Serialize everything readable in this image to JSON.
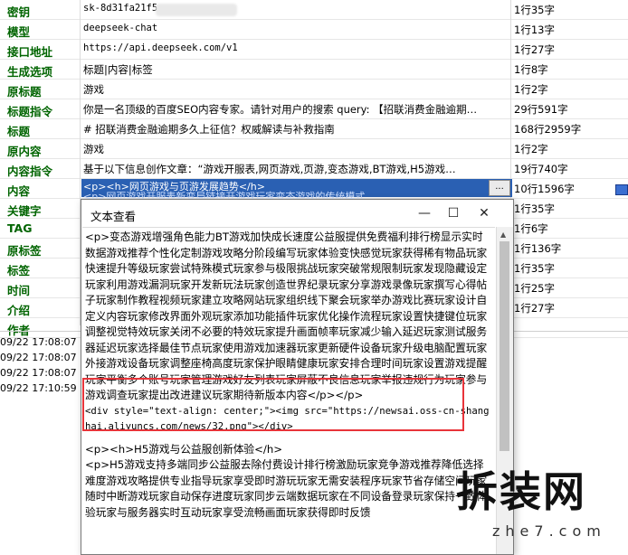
{
  "rows": [
    {
      "label": "密钥",
      "value": "sk-8d31fa21f5",
      "count": "1行35字",
      "mono": true
    },
    {
      "label": "模型",
      "value": "deepseek-chat",
      "count": "1行13字",
      "mono": true
    },
    {
      "label": "接口地址",
      "value": "https://api.deepseek.com/v1",
      "count": "1行27字",
      "mono": true
    },
    {
      "label": "生成选项",
      "value": "标题|内容|标签",
      "count": "1行8字",
      "mono": false
    },
    {
      "label": "原标题",
      "value": "游戏",
      "count": "1行2字",
      "mono": false
    },
    {
      "label": "标题指令",
      "value": "你是一名顶级的百度SEO内容专家。请针对用户的搜索 query: 【招联消费金融逾期…",
      "count": "29行591字",
      "mono": false
    },
    {
      "label": "标题",
      "value": "# 招联消费金融逾期多久上征信？权威解读与补救指南",
      "count": "168行2959字",
      "mono": false
    },
    {
      "label": "原内容",
      "value": "游戏",
      "count": "1行2字",
      "mono": false
    },
    {
      "label": "内容指令",
      "value": "基于以下信息创作文章：“游戏开服表,网页游戏,页游,变态游戏,BT游戏,H5游戏…",
      "count": "19行740字",
      "mono": false
    },
    {
      "label": "内容",
      "value": "",
      "count": "10行1596字",
      "mono": false
    },
    {
      "label": "关键字",
      "value": "",
      "count": "1行35字",
      "mono": false
    },
    {
      "label": "TAG",
      "value": "",
      "count": "1行6字",
      "mono": false
    },
    {
      "label": "原标签",
      "value": "",
      "count": "1行136字",
      "mono": false
    },
    {
      "label": "标签",
      "value": "",
      "count": "1行35字",
      "mono": false
    },
    {
      "label": "时间",
      "value": "",
      "count": "1行25字",
      "mono": false
    },
    {
      "label": "介绍",
      "value": "",
      "count": "1行27字",
      "mono": false
    },
    {
      "label": "作者",
      "value": "",
      "count": "",
      "mono": false
    }
  ],
  "selected": {
    "line1": "<p><h>网页游戏与页游发展趋势</h>",
    "line2": "<p>网页游戏开服表新变局链接开游戏玩家变态游戏的传统模式"
  },
  "dots_label": "...",
  "log": [
    "09/22 17:08:07",
    "09/22 17:08:07",
    "09/22 17:08:07",
    "09/22 17:10:59"
  ],
  "dialog": {
    "title": "文本查看",
    "minimize": "—",
    "maximize": "☐",
    "close": "✕",
    "para1": "<p>变态游戏增强角色能力BT游戏加快成长速度公益服提供免费福利排行榜显示实时数据游戏推荐个性化定制游戏攻略分阶段编写玩家体验变快感觉玩家获得稀有物品玩家快速提升等级玩家尝试特殊模式玩家参与极限挑战玩家突破常规限制玩家发现隐藏设定玩家利用游戏漏洞玩家开发新玩法玩家创造世界纪录玩家分享游戏录像玩家撰写心得帖子玩家制作教程视频玩家建立攻略网站玩家组织线下聚会玩家举办游戏比赛玩家设计自定义内容玩家修改界面外观玩家添加功能插件玩家优化操作流程玩家设置快捷键位玩家调整视觉特效玩家关闭不必要的特效玩家提升画面帧率玩家减少输入延迟玩家测试服务器延迟玩家选择最佳节点玩家使用游戏加速器玩家更新硬件设备玩家升级电脑配置玩家外接游戏设备玩家调整座椅高度玩家保护眼睛健康玩家安排合理时间玩家设置游戏提醒玩家平衡多个账号玩家管理游戏好友列表玩家屏蔽不良信息玩家举报违规行为玩家参与游戏调查玩家提出改进建议玩家期待新版本内容</p></p>",
    "code": "<div style=\"text-align: center;\"><img src=\"https://newsai.oss-cn-shanghai.aliyuncs.com/news/32.png\"></div>",
    "para2_head": "<p><h>H5游戏与公益服创新体验</h>",
    "para2": "<p>H5游戏支持多端同步公益服去除付费设计排行榜激励玩家竞争游戏推荐降低选择难度游戏攻略提供专业指导玩家享受即时游玩玩家无需安装程序玩家节省存储空间玩家随时中断游戏玩家自动保存进度玩家同步云端数据玩家在不同设备登录玩家保持一致体验玩家与服务器实时互动玩家享受流畅画面玩家获得即时反馈"
  },
  "watermark": {
    "big": "拆装网",
    "small": "zhe7.com"
  }
}
